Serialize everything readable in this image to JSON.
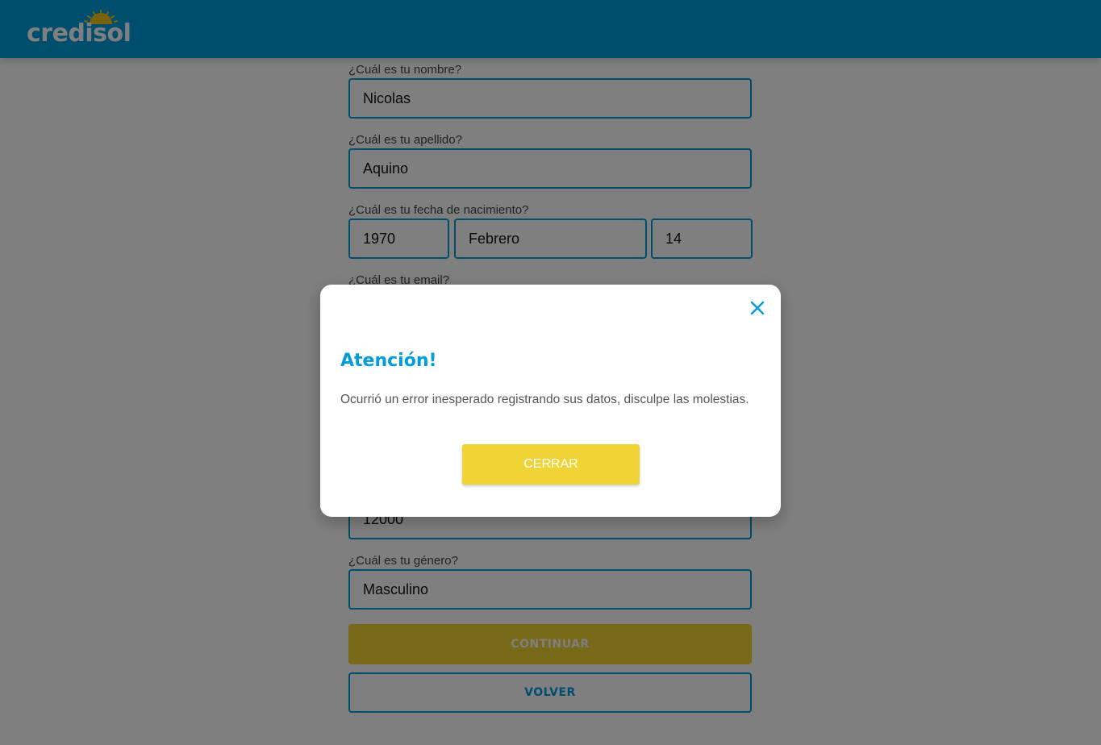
{
  "header": {
    "logo_text": "credisol"
  },
  "form": {
    "name": {
      "label": "¿Cuál es tu nombre?",
      "value": "Nicolas"
    },
    "lastname": {
      "label": "¿Cuál es tu apellido?",
      "value": "Aquino"
    },
    "birthdate": {
      "label": "¿Cuál es tu fecha de nacimiento?",
      "year": "1970",
      "month": "Febrero",
      "day": "14"
    },
    "email": {
      "label": "¿Cuál es tu email?"
    },
    "income": {
      "value": "12000"
    },
    "gender": {
      "label": "¿Cuál es tu género?",
      "value": "Masculino"
    },
    "continue_label": "CONTINUAR",
    "back_label": "VOLVER"
  },
  "modal": {
    "title": "Atención!",
    "message": "Ocurrió un error inesperado registrando sus datos, disculpe las molestias.",
    "close_button": "CERRAR"
  },
  "colors": {
    "brand_blue": "#009ddb",
    "accent_yellow": "#f0d334"
  }
}
